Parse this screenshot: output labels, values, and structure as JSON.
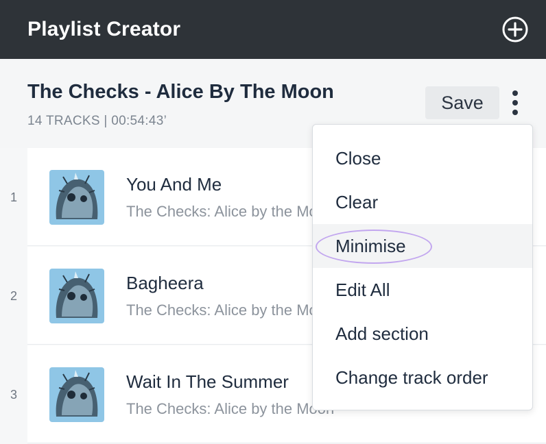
{
  "app": {
    "title": "Playlist Creator",
    "add_icon": "plus-circle-icon"
  },
  "playlist": {
    "title": "The Checks - Alice By The Moon",
    "meta": "14 TRACKS | 00:54:43’",
    "save_label": "Save",
    "more_icon": "kebab-menu-icon"
  },
  "tracks": [
    {
      "number": "1",
      "title": "You And Me",
      "subtitle": "The Checks: Alice by the Moon"
    },
    {
      "number": "2",
      "title": "Bagheera",
      "subtitle": "The Checks: Alice by the Moon"
    },
    {
      "number": "3",
      "title": "Wait In The Summer",
      "subtitle": "The Checks: Alice by the Moon"
    }
  ],
  "menu": {
    "items": [
      {
        "label": "Close"
      },
      {
        "label": "Clear"
      },
      {
        "label": "Minimise",
        "hovered": true
      },
      {
        "label": "Edit All"
      },
      {
        "label": "Add section"
      },
      {
        "label": "Change track order"
      }
    ]
  },
  "colors": {
    "topbar": "#2e3338",
    "highlight": "#c2a6ef",
    "album_art_bg": "#8fc6e6"
  }
}
